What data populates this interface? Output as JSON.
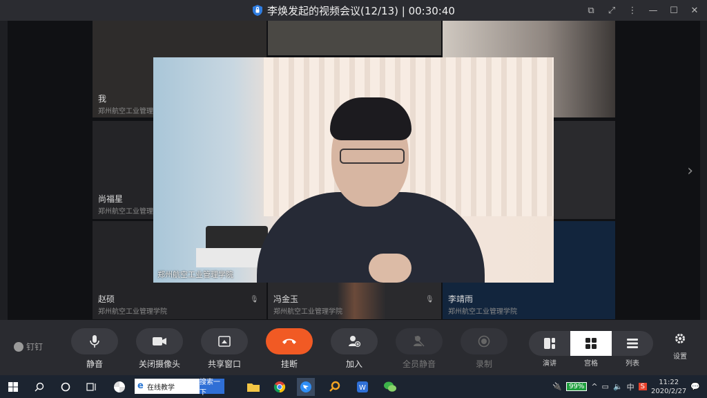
{
  "window": {
    "title": "李焕发起的视频会议(12/13) | 00:30:40",
    "controls": [
      "restore-small",
      "fullscreen",
      "more",
      "minimize",
      "maximize",
      "close"
    ]
  },
  "participants": [
    {
      "name": "我",
      "org": "郑州航空工业管理学院"
    },
    {
      "name": "尚福星",
      "org": "郑州航空工业管理学院"
    },
    {
      "name": "赵硕",
      "org": "郑州航空工业管理学院"
    },
    {
      "name": "冯金玉",
      "org": "郑州航空工业管理学院"
    },
    {
      "name": "李靖雨",
      "org": "郑州航空工业管理学院"
    }
  ],
  "main_video": {
    "caption": "郑州航空工业管理学院"
  },
  "toolbar": {
    "brand": "钉钉",
    "mute": "静音",
    "camera_off": "关闭摄像头",
    "share_window": "共享窗口",
    "hang_up": "挂断",
    "add": "加入",
    "mute_all": "全员静音",
    "record": "录制",
    "view_speaker": "演讲",
    "view_grid": "宫格",
    "view_list": "列表",
    "settings": "设置"
  },
  "taskbar": {
    "search_value": "在线教学",
    "search_button": "搜索一下",
    "battery": "99%",
    "ime": "中",
    "time": "11:22",
    "date": "2020/2/27"
  },
  "colors": {
    "hangup": "#f15a24",
    "toolbar": "#2a2b30",
    "stage": "#101114"
  }
}
